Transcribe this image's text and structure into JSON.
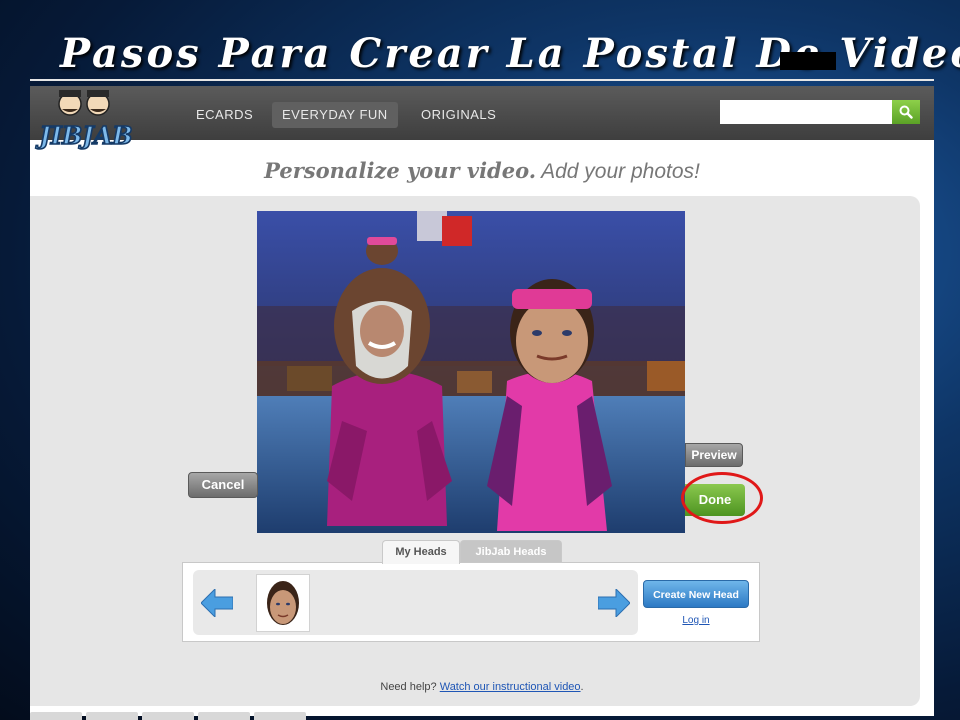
{
  "slide": {
    "title": "Pasos Para Crear La Postal De Video"
  },
  "app": {
    "logo_text": "JIBJAB",
    "nav": [
      {
        "label": "ECARDS"
      },
      {
        "label": "EVERYDAY FUN",
        "active": true
      },
      {
        "label": "ORIGINALS"
      }
    ],
    "search": {
      "value": "",
      "placeholder": ""
    }
  },
  "main": {
    "headline_bold": "Personalize your video.",
    "headline_rest": " Add your photos!",
    "buttons": {
      "cancel": "Cancel",
      "preview": "Preview",
      "done": "Done"
    },
    "tabs": [
      {
        "label": "My Heads",
        "active": true
      },
      {
        "label": "JibJab Heads",
        "active": false
      }
    ],
    "create_head_label": "Create New Head",
    "login_label": "Log in",
    "help_text": "Need help?",
    "help_link": "Watch our instructional video",
    "help_period": "."
  },
  "colors": {
    "accent_green": "#6bb033",
    "highlight_red": "#e01818",
    "link_blue": "#1f56b5"
  }
}
